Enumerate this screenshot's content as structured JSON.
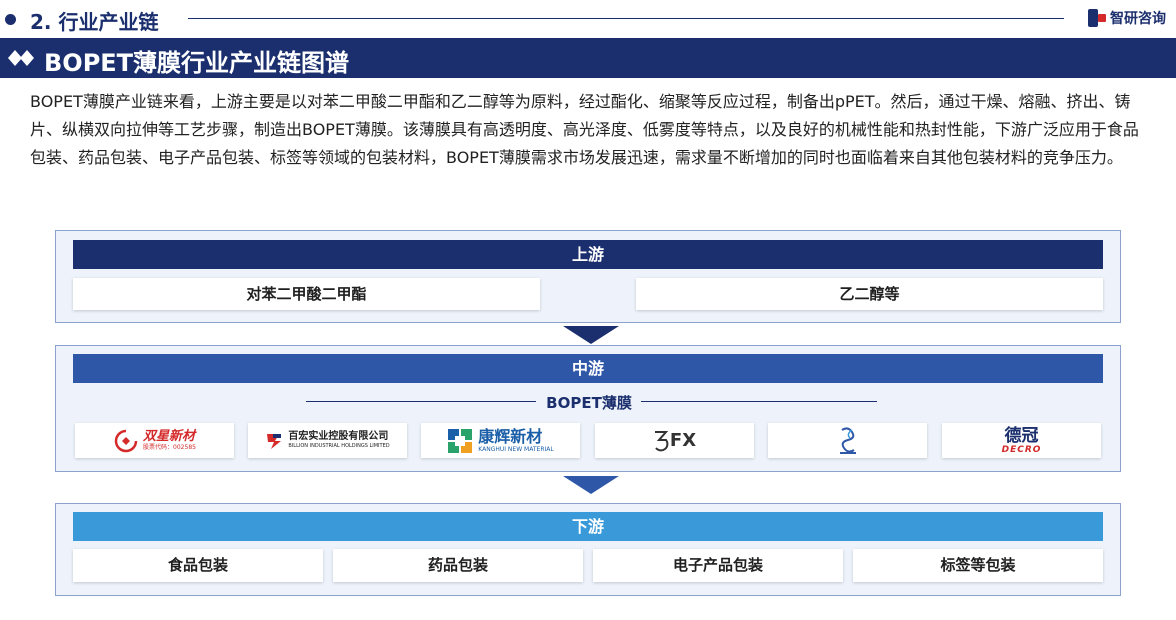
{
  "section": {
    "title": "2. 行业产业链"
  },
  "brand": {
    "name": "智研咨询"
  },
  "banner": {
    "title": "BOPET薄膜行业产业链图谱"
  },
  "intro": {
    "text": "BOPET薄膜产业链来看，上游主要是以对苯二甲酸二甲酯和乙二醇等为原料，经过酯化、缩聚等反应过程，制备出pPET。然后，通过干燥、熔融、挤出、铸片、纵横双向拉伸等工艺步骤，制造出BOPET薄膜。该薄膜具有高透明度、高光泽度、低雾度等特点，以及良好的机械性能和热封性能，下游广泛应用于食品包装、药品包装、电子产品包装、标签等领域的包装材料，BOPET薄膜需求市场发展迅速，需求量不断增加的同时也面临着来自其他包装材料的竞争压力。"
  },
  "colors": {
    "navy": "#1b2f6e",
    "mid_blue": "#2f57a8",
    "light_blue": "#3a9ad9"
  },
  "upstream": {
    "title": "上游",
    "items": [
      "对苯二甲酸二甲酯",
      "乙二醇等"
    ]
  },
  "midstream": {
    "title": "中游",
    "product": "BOPET薄膜",
    "logos": [
      {
        "name": "双星新材",
        "sub": "股票代码：002585"
      },
      {
        "name": "百宏实业控股有限公司",
        "sub": "BILLION INDUSTRIAL HOLDINGS LIMITED"
      },
      {
        "name": "康辉新材",
        "sub": "KANGHUI NEW MATERIAL"
      },
      {
        "name": "FX",
        "sub": ""
      },
      {
        "name": "",
        "sub": ""
      },
      {
        "name": "德冠",
        "sub": "DECRO"
      }
    ]
  },
  "downstream": {
    "title": "下游",
    "items": [
      "食品包装",
      "药品包装",
      "电子产品包装",
      "标签等包装"
    ]
  }
}
